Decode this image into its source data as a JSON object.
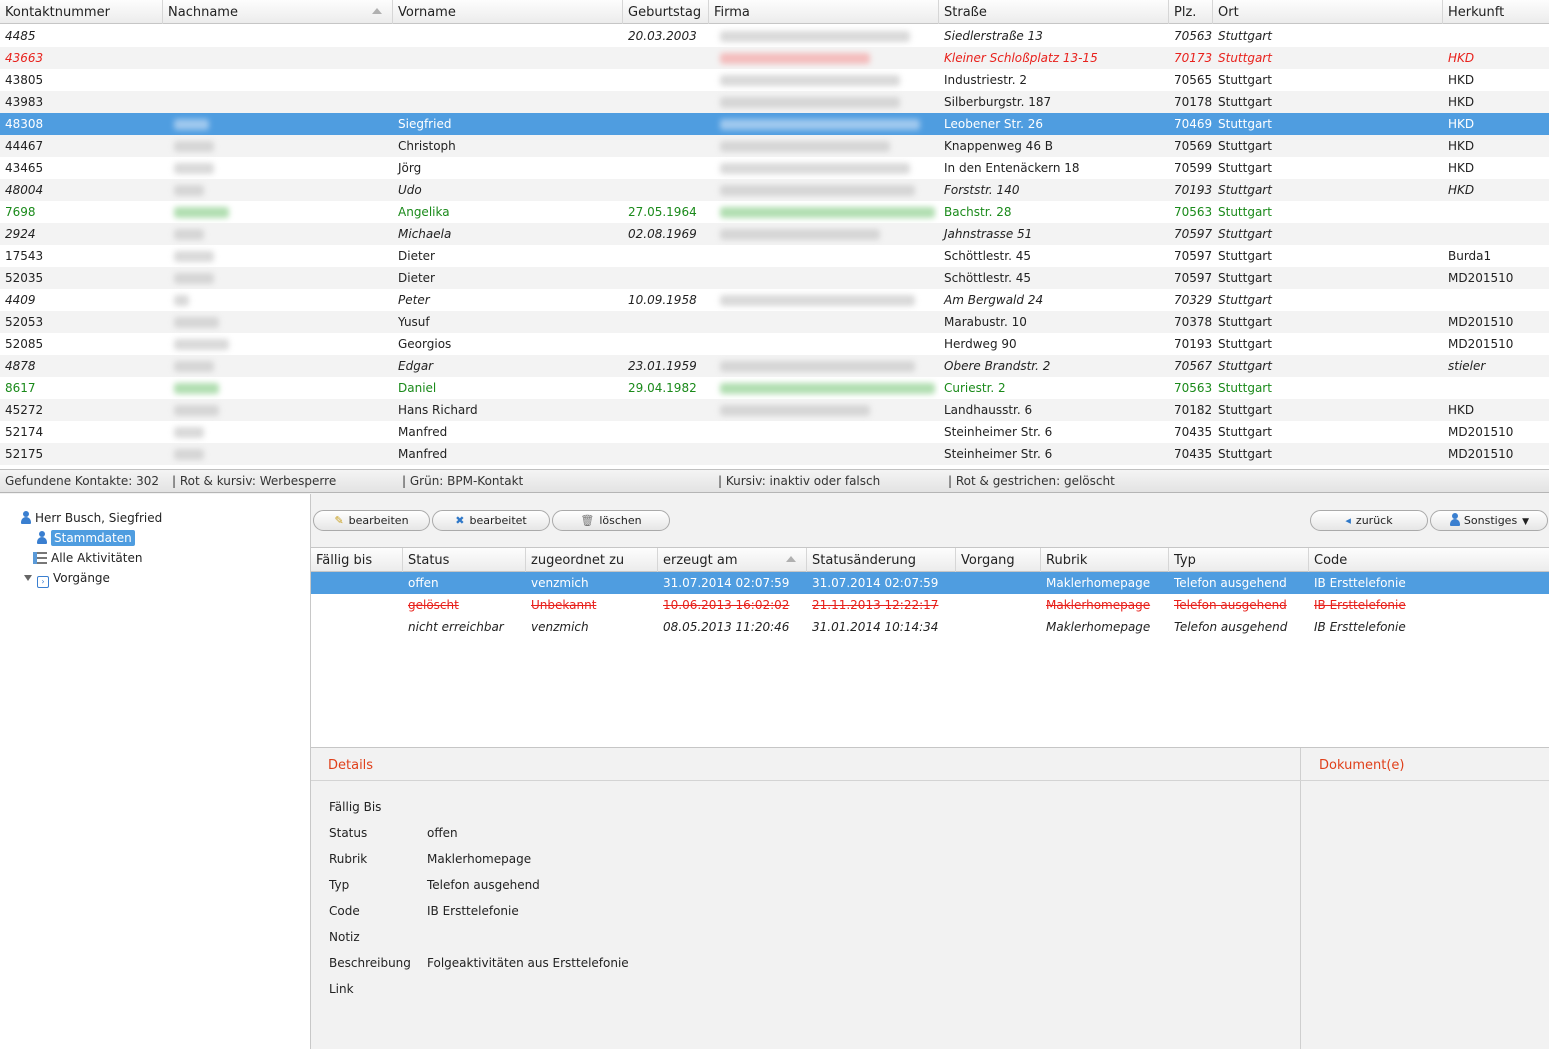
{
  "contacts": {
    "columns": [
      "Kontaktnummer",
      "Nachname",
      "Vorname",
      "Geburtstag",
      "Firma",
      "Straße",
      "Plz.",
      "Ort",
      "Herkunft"
    ],
    "rows": [
      {
        "nr": "4485",
        "vorname": "",
        "geburtstag": "20.03.2003",
        "strasse": "Siedlerstraße 13",
        "plz": "70563",
        "ort": "Stuttgart",
        "herkunft": "",
        "style": "italic",
        "nw": 0,
        "fw": 190
      },
      {
        "nr": "43663",
        "vorname": "",
        "geburtstag": "",
        "strasse": "Kleiner Schloßplatz 13-15",
        "plz": "70173",
        "ort": "Stuttgart",
        "herkunft": "HKD",
        "style": "red",
        "nw": 0,
        "fw": 150
      },
      {
        "nr": "43805",
        "vorname": "",
        "geburtstag": "",
        "strasse": "Industriestr. 2",
        "plz": "70565",
        "ort": "Stuttgart",
        "herkunft": "HKD",
        "style": "normal",
        "nw": 0,
        "fw": 180
      },
      {
        "nr": "43983",
        "vorname": "",
        "geburtstag": "",
        "strasse": "Silberburgstr. 187",
        "plz": "70178",
        "ort": "Stuttgart",
        "herkunft": "HKD",
        "style": "normal",
        "nw": 0,
        "fw": 180
      },
      {
        "nr": "48308",
        "vorname": "Siegfried",
        "geburtstag": "",
        "strasse": "Leobener Str. 26",
        "plz": "70469",
        "ort": "Stuttgart",
        "herkunft": "HKD",
        "style": "selected",
        "nw": 35,
        "fw": 200
      },
      {
        "nr": "44467",
        "vorname": "Christoph",
        "geburtstag": "",
        "strasse": "Knappenweg 46 B",
        "plz": "70569",
        "ort": "Stuttgart",
        "herkunft": "HKD",
        "style": "normal",
        "nw": 40,
        "fw": 170
      },
      {
        "nr": "43465",
        "vorname": "Jörg",
        "geburtstag": "",
        "strasse": "In den Entenäckern 18",
        "plz": "70599",
        "ort": "Stuttgart",
        "herkunft": "HKD",
        "style": "normal",
        "nw": 40,
        "fw": 190
      },
      {
        "nr": "48004",
        "vorname": "Udo",
        "geburtstag": "",
        "strasse": "Forststr. 140",
        "plz": "70193",
        "ort": "Stuttgart",
        "herkunft": "HKD",
        "style": "italic",
        "nw": 30,
        "fw": 195
      },
      {
        "nr": "7698",
        "vorname": "Angelika",
        "geburtstag": "27.05.1964",
        "strasse": "Bachstr. 28",
        "plz": "70563",
        "ort": "Stuttgart",
        "herkunft": "",
        "style": "green",
        "nw": 55,
        "fw": 215
      },
      {
        "nr": "2924",
        "vorname": "Michaela",
        "geburtstag": "02.08.1969",
        "strasse": "Jahnstrasse 51",
        "plz": "70597",
        "ort": "Stuttgart",
        "herkunft": "",
        "style": "italic",
        "nw": 30,
        "fw": 160
      },
      {
        "nr": "17543",
        "vorname": "Dieter",
        "geburtstag": "",
        "strasse": "Schöttlestr. 45",
        "plz": "70597",
        "ort": "Stuttgart",
        "herkunft": "Burda1",
        "style": "normal",
        "nw": 40,
        "fw": 0
      },
      {
        "nr": "52035",
        "vorname": "Dieter",
        "geburtstag": "",
        "strasse": "Schöttlestr. 45",
        "plz": "70597",
        "ort": "Stuttgart",
        "herkunft": "MD201510",
        "style": "normal",
        "nw": 40,
        "fw": 0
      },
      {
        "nr": "4409",
        "vorname": "Peter",
        "geburtstag": "10.09.1958",
        "strasse": "Am Bergwald 24",
        "plz": "70329",
        "ort": "Stuttgart",
        "herkunft": "",
        "style": "italic",
        "nw": 15,
        "fw": 195
      },
      {
        "nr": "52053",
        "vorname": "Yusuf",
        "geburtstag": "",
        "strasse": "Marabustr. 10",
        "plz": "70378",
        "ort": "Stuttgart",
        "herkunft": "MD201510",
        "style": "normal",
        "nw": 45,
        "fw": 0
      },
      {
        "nr": "52085",
        "vorname": "Georgios",
        "geburtstag": "",
        "strasse": "Herdweg 90",
        "plz": "70193",
        "ort": "Stuttgart",
        "herkunft": "MD201510",
        "style": "normal",
        "nw": 55,
        "fw": 0
      },
      {
        "nr": "4878",
        "vorname": "Edgar",
        "geburtstag": "23.01.1959",
        "strasse": "Obere Brandstr. 2",
        "plz": "70567",
        "ort": "Stuttgart",
        "herkunft": "stieler",
        "style": "italic",
        "nw": 40,
        "fw": 195
      },
      {
        "nr": "8617",
        "vorname": "Daniel",
        "geburtstag": "29.04.1982",
        "strasse": "Curiestr. 2",
        "plz": "70563",
        "ort": "Stuttgart",
        "herkunft": "",
        "style": "green",
        "nw": 45,
        "fw": 215
      },
      {
        "nr": "45272",
        "vorname": "Hans Richard",
        "geburtstag": "",
        "strasse": "Landhausstr. 6",
        "plz": "70182",
        "ort": "Stuttgart",
        "herkunft": "HKD",
        "style": "normal",
        "nw": 45,
        "fw": 150
      },
      {
        "nr": "52174",
        "vorname": "Manfred",
        "geburtstag": "",
        "strasse": "Steinheimer Str. 6",
        "plz": "70435",
        "ort": "Stuttgart",
        "herkunft": "MD201510",
        "style": "normal",
        "nw": 30,
        "fw": 0
      },
      {
        "nr": "52175",
        "vorname": "Manfred",
        "geburtstag": "",
        "strasse": "Steinheimer Str. 6",
        "plz": "70435",
        "ort": "Stuttgart",
        "herkunft": "MD201510",
        "style": "normal",
        "nw": 30,
        "fw": 0
      }
    ]
  },
  "statusbar": {
    "found": "Gefundene Kontakte: 302",
    "legend_red": "| Rot & kursiv: Werbesperre",
    "legend_green": "| Grün: BPM-Kontakt",
    "legend_italic": "| Kursiv: inaktiv oder falsch",
    "legend_strike": "| Rot & gestrichen: gelöscht"
  },
  "tree": {
    "root": "Herr Busch, Siegfried",
    "stammdaten": "Stammdaten",
    "aktivitaeten": "Alle Aktivitäten",
    "vorgaenge": "Vorgänge"
  },
  "toolbar": {
    "edit": "bearbeiten",
    "edited": "bearbeitet",
    "delete": "löschen",
    "back": "zurück",
    "other": "Sonstiges"
  },
  "activities": {
    "columns": [
      "Fällig bis",
      "Status",
      "zugeordnet zu",
      "erzeugt am",
      "Statusänderung",
      "Vorgang",
      "Rubrik",
      "Typ",
      "Code"
    ],
    "rows": [
      {
        "faellig": "",
        "status": "offen",
        "zugeordnet": "venzmich",
        "erzeugt": "31.07.2014 02:07:59",
        "aenderung": "31.07.2014 02:07:59",
        "vorgang": "",
        "rubrik": "Maklerhomepage",
        "typ": "Telefon ausgehend",
        "code": "IB Ersttelefonie",
        "style": "selected"
      },
      {
        "faellig": "",
        "status": "gelöscht",
        "zugeordnet": "Unbekannt",
        "erzeugt": "10.06.2013 16:02:02",
        "aenderung": "21.11.2013 12:22:17",
        "vorgang": "",
        "rubrik": "Maklerhomepage",
        "typ": "Telefon ausgehend",
        "code": "IB Ersttelefonie",
        "style": "deleted"
      },
      {
        "faellig": "",
        "status": "nicht erreichbar",
        "zugeordnet": "venzmich",
        "erzeugt": "08.05.2013 11:20:46",
        "aenderung": "31.01.2014 10:14:34",
        "vorgang": "",
        "rubrik": "Maklerhomepage",
        "typ": "Telefon ausgehend",
        "code": "IB Ersttelefonie",
        "style": "italic"
      }
    ]
  },
  "details": {
    "title": "Details",
    "fields": [
      {
        "label": "Fällig Bis",
        "value": ""
      },
      {
        "label": "Status",
        "value": "offen"
      },
      {
        "label": "Rubrik",
        "value": "Maklerhomepage"
      },
      {
        "label": "Typ",
        "value": "Telefon ausgehend"
      },
      {
        "label": "Code",
        "value": "IB Ersttelefonie"
      },
      {
        "label": "Notiz",
        "value": ""
      },
      {
        "label": "Beschreibung",
        "value": "Folgeaktivitäten aus Ersttelefonie"
      },
      {
        "label": "Link",
        "value": ""
      }
    ]
  },
  "documents": {
    "title": "Dokument(e)"
  },
  "colors": {
    "selection": "#4f9de0",
    "red": "#e8211c",
    "green": "#1a8a1a",
    "panel_title": "#e0401a"
  }
}
